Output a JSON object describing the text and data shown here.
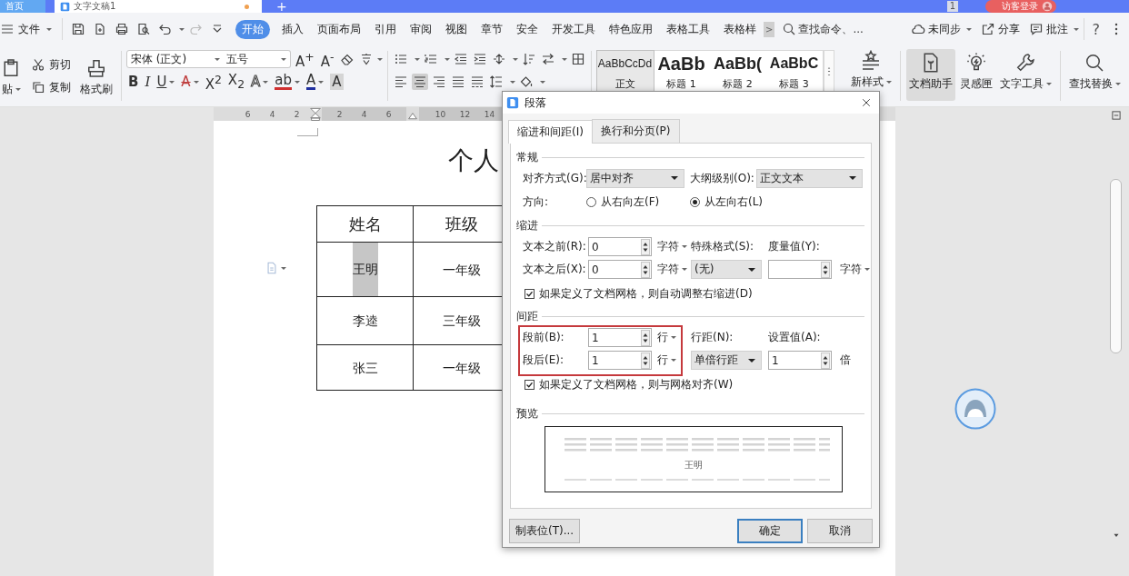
{
  "title_bar": {
    "tabs": [
      {
        "label": "首页",
        "selected": false,
        "unsaved": false
      },
      {
        "label": "文字文稿1",
        "selected": true,
        "unsaved": true
      }
    ],
    "new_tab": "+",
    "window_count": "1",
    "login": "访客登录"
  },
  "menu_bar": {
    "file": "文件",
    "tabs": [
      {
        "label": "开始",
        "selected": true
      },
      {
        "label": "插入",
        "selected": false
      },
      {
        "label": "页面布局",
        "selected": false
      },
      {
        "label": "引用",
        "selected": false
      },
      {
        "label": "审阅",
        "selected": false
      },
      {
        "label": "视图",
        "selected": false
      },
      {
        "label": "章节",
        "selected": false
      },
      {
        "label": "安全",
        "selected": false
      },
      {
        "label": "开发工具",
        "selected": false
      },
      {
        "label": "特色应用",
        "selected": false
      },
      {
        "label": "表格工具",
        "selected": false
      },
      {
        "label": "表格样",
        "selected": false
      }
    ],
    "scroll": ">",
    "search": {
      "placeholder": "查找命令、..."
    },
    "actions": [
      {
        "label": "未同步",
        "kind": "cloud",
        "dropdown": true
      },
      {
        "label": "分享",
        "kind": "share",
        "dropdown": false
      },
      {
        "label": "批注",
        "kind": "comment",
        "dropdown": true
      }
    ],
    "help": "?"
  },
  "ribbon": {
    "clipboard": {
      "paste": "贴",
      "cut": "剪切",
      "copy": "复制",
      "format_painter": "格式刷"
    },
    "font": {
      "family": "宋体 (正文)",
      "size": "五号",
      "size_tools": [
        {
          "label": "A$^{+}$",
          "dropdown": false
        },
        {
          "label": "A$^{-}$",
          "dropdown": false
        }
      ],
      "tools": [
        {
          "label": "B",
          "kind": "bold",
          "dropdown": false
        },
        {
          "label": "I",
          "kind": "italic",
          "dropdown": false
        },
        {
          "label": "U",
          "kind": "underline",
          "dropdown": true
        },
        {
          "label": "A",
          "kind": "strike",
          "dropdown": true
        },
        {
          "label": "X$^{2}$",
          "dropdown": false
        },
        {
          "label": "X$_{2}$",
          "dropdown": false
        },
        {
          "label": "A",
          "kind": "outline",
          "dropdown": true
        },
        {
          "label": "ab",
          "kind": "highlight",
          "dropdown": true
        },
        {
          "label": "A",
          "kind": "color",
          "dropdown": true
        },
        {
          "label": "A",
          "kind": "shaded",
          "dropdown": false
        }
      ]
    },
    "paragraph": {
      "alignments": [
        {
          "kind": "left",
          "selected": false
        },
        {
          "kind": "center",
          "selected": true
        },
        {
          "kind": "right",
          "selected": false
        },
        {
          "kind": "justify",
          "selected": false
        },
        {
          "kind": "distributed",
          "selected": false
        }
      ]
    },
    "styles": [
      {
        "preview": "AaBbCcDd",
        "label": "正文",
        "kind": "body",
        "selected": true
      },
      {
        "preview": "AaBb",
        "label": "标题 1",
        "kind": "heading1",
        "selected": false
      },
      {
        "preview": "AaBb(",
        "label": "标题 2",
        "kind": "heading2",
        "selected": false
      },
      {
        "preview": "AaBbC",
        "label": "标题 3",
        "kind": "heading3",
        "selected": false
      }
    ],
    "new_style": "新样式",
    "tools": [
      {
        "label": "文档助手",
        "kind": "assistant",
        "selected": true,
        "dropdown": false
      },
      {
        "label": "灵感匣",
        "kind": "bulb",
        "selected": false,
        "dropdown": false
      },
      {
        "label": "文字工具",
        "kind": "wrench",
        "selected": false,
        "dropdown": true
      },
      {
        "label": "查找替换",
        "kind": "search",
        "selected": false,
        "dropdown": true
      }
    ]
  },
  "ruler": {
    "segments": [
      [
        "6",
        "4",
        "2"
      ],
      [
        "2",
        "4",
        "6"
      ],
      [
        "10",
        "12",
        "14"
      ]
    ]
  },
  "document": {
    "title": "个人",
    "table": {
      "columns": [
        "姓名",
        "班级"
      ],
      "rows": [
        {
          "cells": [
            "王明",
            "一年级"
          ],
          "selected": true
        },
        {
          "cells": [
            "李逵",
            "三年级"
          ],
          "selected": false
        },
        {
          "cells": [
            "张三",
            "一年级"
          ],
          "selected": false
        }
      ]
    }
  },
  "dialog": {
    "title": "段落",
    "tabs": [
      {
        "label": "缩进和间距(I)",
        "selected": true
      },
      {
        "label": "换行和分页(P)",
        "selected": false
      }
    ],
    "general": {
      "heading": "常规",
      "alignment": {
        "label": "对齐方式(G):",
        "value": "居中对齐"
      },
      "outline": {
        "label": "大纲级别(O):",
        "value": "正文文本"
      },
      "direction": {
        "label": "方向:",
        "options": [
          {
            "label": "从右向左(F)",
            "selected": false
          },
          {
            "label": "从左向右(L)",
            "selected": true
          }
        ]
      }
    },
    "indent": {
      "heading": "缩进",
      "before": {
        "label": "文本之前(R):",
        "value": "0",
        "unit": "字符"
      },
      "after": {
        "label": "文本之后(X):",
        "value": "0",
        "unit": "字符"
      },
      "special": {
        "label": "特殊格式(S):",
        "value": "(无)"
      },
      "measure": {
        "label": "度量值(Y):",
        "unit": "字符"
      },
      "auto_adjust": {
        "label": "如果定义了文档网格，则自动调整右缩进(D)",
        "checked": true
      }
    },
    "spacing": {
      "heading": "间距",
      "highlighted": true,
      "before": {
        "label": "段前(B):",
        "value": "1",
        "unit": "行"
      },
      "after": {
        "label": "段后(E):",
        "value": "1",
        "unit": "行"
      },
      "line_spacing": {
        "label": "行距(N):",
        "value": "单倍行距"
      },
      "amount": {
        "label": "设置值(A):",
        "value": "1",
        "unit": "倍"
      },
      "snap_to_grid": {
        "label": "如果定义了文档网格，则与网格对齐(W)",
        "checked": true
      }
    },
    "preview": {
      "heading": "预览",
      "sample": "王明"
    },
    "buttons": [
      {
        "label": "制表位(T)...",
        "kind": "normal"
      },
      {
        "label": "确定",
        "kind": "default"
      },
      {
        "label": "取消",
        "kind": "normal"
      }
    ]
  }
}
